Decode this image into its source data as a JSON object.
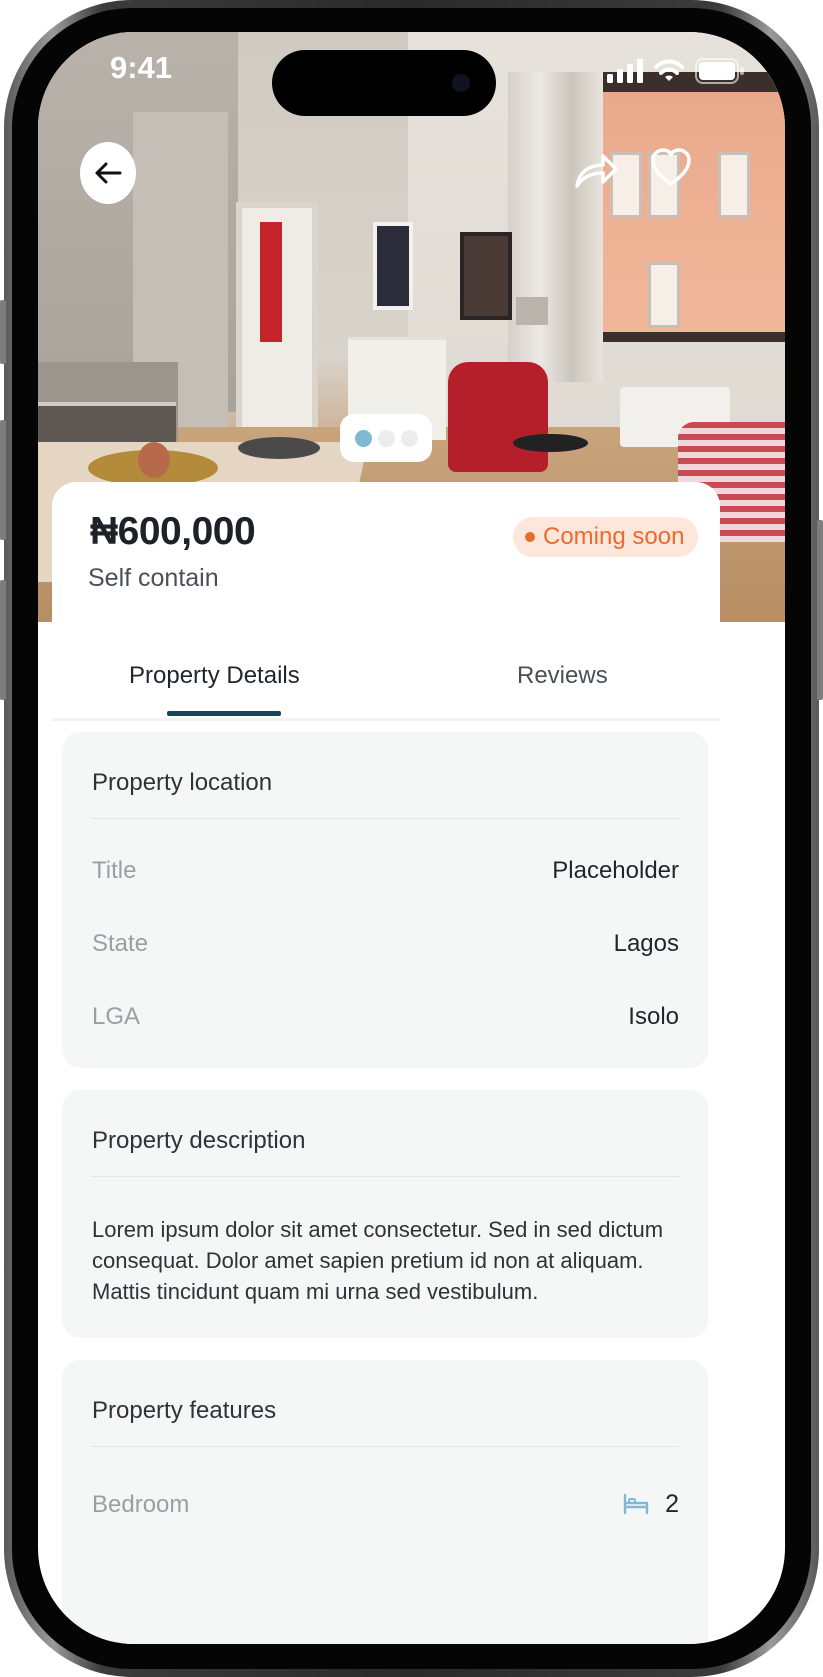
{
  "status_bar": {
    "time": "9:41"
  },
  "hero": {
    "back_icon": "arrow-left-icon",
    "share_icon": "share-arrow-icon",
    "favorite_icon": "heart-outline-icon",
    "pager_dots": 3,
    "pager_active_index": 0
  },
  "listing": {
    "price": "₦600,000",
    "type": "Self contain",
    "status_badge": "Coming soon"
  },
  "tabs": [
    {
      "label": "Property Details",
      "active": true
    },
    {
      "label": "Reviews",
      "active": false
    }
  ],
  "location": {
    "title": "Property location",
    "rows": [
      {
        "label": "Title",
        "value": "Placeholder"
      },
      {
        "label": "State",
        "value": "Lagos"
      },
      {
        "label": "LGA",
        "value": "Isolo"
      }
    ]
  },
  "description": {
    "title": "Property description",
    "text": "Lorem ipsum dolor sit amet consectetur. Sed in sed dictum consequat. Dolor amet sapien pretium id non at aliquam. Mattis tincidunt quam mi urna sed vestibulum."
  },
  "features": {
    "title": "Property features",
    "rows": [
      {
        "label": "Bedroom",
        "icon": "bed-icon",
        "value": "2"
      }
    ]
  },
  "colors": {
    "accent": "#12475a",
    "badge_text": "#ea6b2a",
    "badge_bg": "#fde6dc",
    "pager_active": "#7fb9d3",
    "section_bg": "#f5f7f6"
  }
}
